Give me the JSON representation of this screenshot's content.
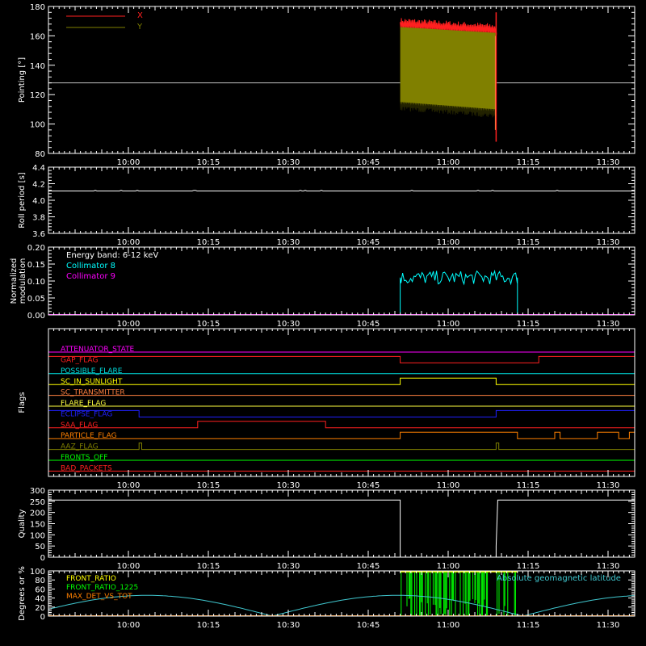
{
  "colors": {
    "background": "#000000",
    "axes": "#ffffff",
    "x_pointing": "#ff2020",
    "y_pointing": "#808000",
    "collimator8": "#00ffff",
    "collimator9": "#ff00ff",
    "energy_label": "#ffffff",
    "geomag": "#40c8d0",
    "front_ratio": "#ffff00",
    "front_ratio_1225": "#00ff00",
    "max_det_vs_tot": "#ff8000"
  },
  "time_axis": {
    "start_minutes": 585,
    "end_minutes": 695,
    "ticks": [
      "10:00",
      "10:15",
      "10:30",
      "10:45",
      "11:00",
      "11:15",
      "11:30"
    ]
  },
  "chart_data": [
    {
      "type": "line",
      "ylabel": "Pointing [°]",
      "ylim": [
        80,
        180
      ],
      "yticks": [
        "80",
        "100",
        "120",
        "140",
        "160",
        "180"
      ],
      "legend": [
        "X",
        "Y"
      ],
      "legend_placement": "top-left",
      "series": [
        {
          "name": "X",
          "baseline": 128,
          "active_from": "10:51",
          "active_to": "11:09",
          "band_low": 112,
          "band_high_start": 170,
          "band_high_end": 166,
          "spike_low": 88
        },
        {
          "name": "Y",
          "baseline": 128,
          "active_from": "10:51",
          "active_to": "11:09",
          "band_low_start": 113,
          "band_low_end": 108,
          "band_high_start": 166,
          "band_high_end": 162
        }
      ]
    },
    {
      "type": "line",
      "ylabel": "Roll period [s]",
      "ylim": [
        3.5,
        4.5
      ],
      "yticks": [
        "3.6",
        "3.8",
        "4.0",
        "4.2",
        "4.4"
      ],
      "series": [
        {
          "name": "",
          "value": 4.14
        }
      ]
    },
    {
      "type": "line",
      "ylabel": "Normalized modulation",
      "ylim": [
        0,
        0.2
      ],
      "yticks": [
        "0.00",
        "0.05",
        "0.10",
        "0.15",
        "0.20"
      ],
      "legend": [
        "Energy band: 6-12 keV",
        "Collimator 8",
        "Collimator 9"
      ],
      "legend_placement": "top-left",
      "series": [
        {
          "name": "Collimator 8",
          "baseline": 0,
          "active_from": "10:51",
          "active_to": "11:13",
          "level": 0.11,
          "spread": 0.02
        },
        {
          "name": "Collimator 9",
          "value": 0
        }
      ]
    },
    {
      "type": "line",
      "ylabel": "Flags",
      "flags": [
        {
          "label": "ATTENUATOR_STATE",
          "color": "#ff00ff",
          "segments": [
            [
              585,
              0
            ],
            [
              695,
              0
            ]
          ]
        },
        {
          "label": "GAP_FLAG",
          "color": "#ff2020",
          "segments": [
            [
              585,
              1
            ],
            [
              651,
              1
            ],
            [
              651,
              0
            ],
            [
              677,
              0
            ],
            [
              677,
              1
            ],
            [
              695,
              1
            ]
          ]
        },
        {
          "label": "POSSIBLE_FLARE",
          "color": "#00e0e0",
          "segments": [
            [
              585,
              0
            ],
            [
              695,
              0
            ]
          ]
        },
        {
          "label": "SC_IN_SUNLIGHT",
          "color": "#ffff00",
          "segments": [
            [
              585,
              0
            ],
            [
              651,
              0
            ],
            [
              651,
              1
            ],
            [
              669,
              1
            ],
            [
              669,
              0
            ],
            [
              695,
              0
            ]
          ]
        },
        {
          "label": "SC_TRANSMITTER",
          "color": "#ff8040",
          "segments": [
            [
              585,
              0
            ],
            [
              695,
              0
            ]
          ]
        },
        {
          "label": "FLARE_FLAG",
          "color": "#ffff40",
          "segments": [
            [
              585,
              0
            ],
            [
              695,
              0
            ]
          ]
        },
        {
          "label": "ECLIPSE_FLAG",
          "color": "#2020ff",
          "segments": [
            [
              585,
              1
            ],
            [
              602,
              1
            ],
            [
              602,
              0
            ],
            [
              669,
              0
            ],
            [
              669,
              1
            ],
            [
              695,
              1
            ]
          ]
        },
        {
          "label": "SAA_FLAG",
          "color": "#ff2020",
          "segments": [
            [
              585,
              0
            ],
            [
              613,
              0
            ],
            [
              613,
              1
            ],
            [
              637,
              1
            ],
            [
              637,
              0
            ],
            [
              695,
              0
            ]
          ]
        },
        {
          "label": "PARTICLE_FLAG",
          "color": "#ff8000",
          "segments": [
            [
              585,
              0
            ],
            [
              651,
              0
            ],
            [
              651,
              1
            ],
            [
              673,
              1
            ],
            [
              673,
              0
            ],
            [
              680,
              0
            ],
            [
              680,
              1
            ],
            [
              681,
              1
            ],
            [
              681,
              0
            ],
            [
              688,
              0
            ],
            [
              688,
              1
            ],
            [
              692,
              1
            ],
            [
              692,
              0
            ],
            [
              694,
              0
            ],
            [
              694,
              1
            ],
            [
              695,
              1
            ]
          ]
        },
        {
          "label": "AAZ_FLAG",
          "color": "#808000",
          "segments": [
            [
              585,
              0
            ],
            [
              602,
              0
            ],
            [
              602,
              1
            ],
            [
              602.5,
              1
            ],
            [
              602.5,
              0
            ],
            [
              669,
              0
            ],
            [
              669,
              1
            ],
            [
              669.5,
              1
            ],
            [
              669.5,
              0
            ],
            [
              695,
              0
            ]
          ]
        },
        {
          "label": "FRONTS_OFF",
          "color": "#00ff00",
          "segments": [
            [
              585,
              0
            ],
            [
              695,
              0
            ]
          ]
        },
        {
          "label": "BAD_PACKETS",
          "color": "#ff2020",
          "segments": [
            [
              585,
              0
            ],
            [
              695,
              0
            ]
          ]
        }
      ]
    },
    {
      "type": "line",
      "ylabel": "Quality",
      "ylim": [
        0,
        300
      ],
      "yticks": [
        "0",
        "50",
        "100",
        "150",
        "200",
        "250",
        "300"
      ],
      "series": [
        {
          "name": "",
          "points": [
            [
              585,
              256
            ],
            [
              651,
              256
            ],
            [
              651,
              0
            ],
            [
              669,
              0
            ],
            [
              669,
              50
            ],
            [
              669.3,
              256
            ],
            [
              695,
              256
            ]
          ]
        }
      ]
    },
    {
      "type": "line",
      "ylabel": "Degrees or %",
      "ylim": [
        0,
        100
      ],
      "yticks": [
        "0",
        "20",
        "40",
        "60",
        "80",
        "100"
      ],
      "legend": [
        "FRONT_RATIO",
        "FRONT_RATIO_1225",
        "MAX_DET_VS_TOT",
        "Absolute geomagnetic latitude"
      ],
      "legend_placement": "top-left",
      "series": [
        {
          "name": "Absolute geomagnetic latitude",
          "amplitude": 46,
          "zeros": [
            627,
            674
          ]
        },
        {
          "name": "FRONT_RATIO_1225",
          "active_from": "10:51",
          "active_to": "11:13",
          "level": 100
        },
        {
          "name": "FRONT_RATIO",
          "active_from": "10:51",
          "active_to": "11:13",
          "level": 100
        },
        {
          "name": "MAX_DET_VS_TOT",
          "value": 0
        }
      ]
    }
  ]
}
